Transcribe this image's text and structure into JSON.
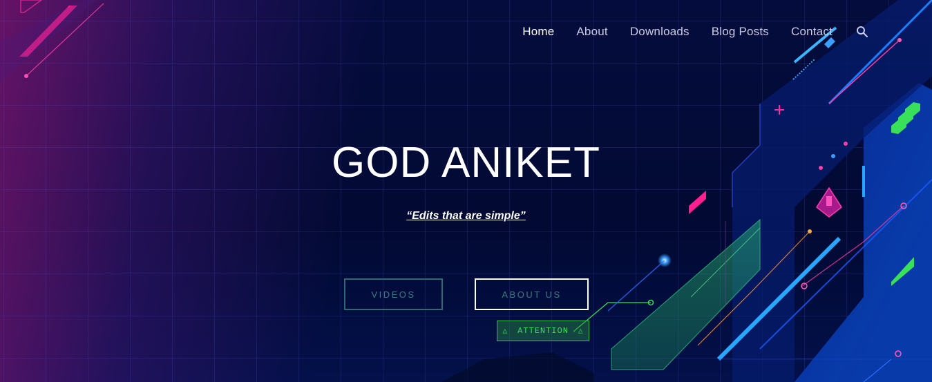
{
  "nav": {
    "items": [
      {
        "label": "Home",
        "active": true
      },
      {
        "label": "About"
      },
      {
        "label": "Downloads"
      },
      {
        "label": "Blog Posts"
      },
      {
        "label": "Contact"
      }
    ],
    "search_icon": "search-icon"
  },
  "hero": {
    "title": "GOD ANIKET",
    "tagline": "“Edits that are simple”",
    "buttons": {
      "videos": "VIDEOS",
      "about_us": "ABOUT US"
    },
    "badge": {
      "label": "ATTENTION",
      "icon": "triangle-icon"
    }
  },
  "colors": {
    "background": "#020a35",
    "accent_pink": "#ff1f8e",
    "accent_blue": "#1e8cff",
    "accent_green": "#39e05a",
    "button_outline_teal": "#2d6b6e"
  }
}
